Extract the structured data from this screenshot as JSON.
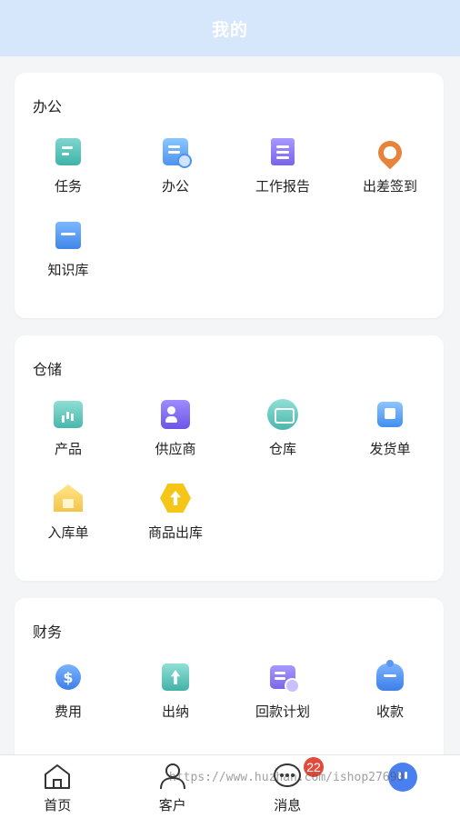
{
  "header": {
    "title": "我的"
  },
  "sections": [
    {
      "title": "办公",
      "items": [
        {
          "label": "任务",
          "icon": "task-icon"
        },
        {
          "label": "办公",
          "icon": "office-icon"
        },
        {
          "label": "工作报告",
          "icon": "report-icon"
        },
        {
          "label": "出差签到",
          "icon": "location-icon"
        },
        {
          "label": "知识库",
          "icon": "book-icon"
        }
      ]
    },
    {
      "title": "仓储",
      "items": [
        {
          "label": "产品",
          "icon": "chart-box-icon"
        },
        {
          "label": "供应商",
          "icon": "contact-card-icon"
        },
        {
          "label": "仓库",
          "icon": "warehouse-icon"
        },
        {
          "label": "发货单",
          "icon": "package-icon"
        },
        {
          "label": "入库单",
          "icon": "house-icon"
        },
        {
          "label": "商品出库",
          "icon": "upload-hexagon-icon"
        }
      ]
    },
    {
      "title": "财务",
      "items": [
        {
          "label": "费用",
          "icon": "dollar-coin-icon"
        },
        {
          "label": "出纳",
          "icon": "upload-box-icon"
        },
        {
          "label": "回款计划",
          "icon": "schedule-icon"
        },
        {
          "label": "收款",
          "icon": "money-bag-icon"
        }
      ]
    }
  ],
  "bottom_nav": {
    "items": [
      {
        "label": "首页",
        "icon": "home-icon"
      },
      {
        "label": "客户",
        "icon": "user-icon"
      },
      {
        "label": "消息",
        "icon": "message-icon",
        "badge": "22"
      },
      {
        "label": "",
        "icon": "me-icon"
      }
    ]
  },
  "watermark": "https://www.huzhan.com/ishop27690",
  "colors": {
    "header_bg": "#d6e6fb",
    "badge": "#e04b3c",
    "page_bg": "#f4f5f7"
  }
}
